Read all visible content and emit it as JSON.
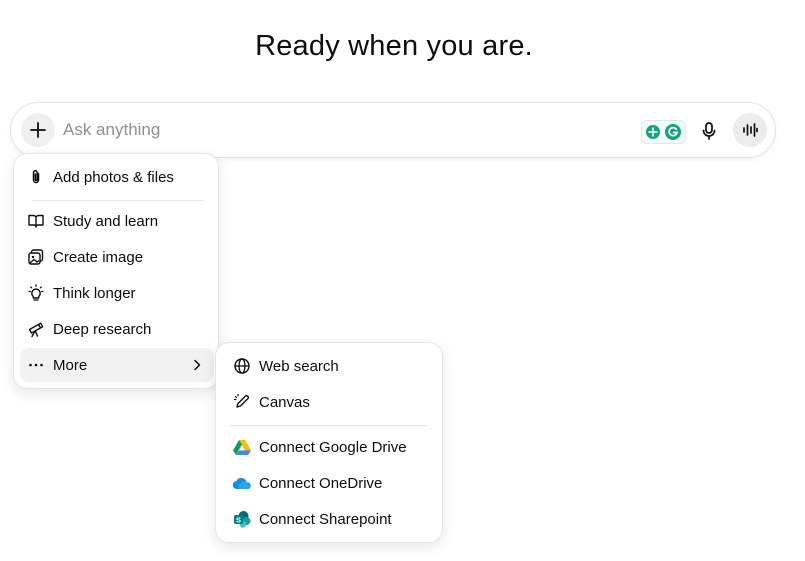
{
  "headline": "Ready when you are.",
  "composer": {
    "placeholder": "Ask anything",
    "value": ""
  },
  "attach_menu": {
    "items": [
      {
        "label": "Add photos & files",
        "icon": "paperclip-icon"
      },
      {
        "label": "Study and learn",
        "icon": "book-icon"
      },
      {
        "label": "Create image",
        "icon": "image-icon"
      },
      {
        "label": "Think longer",
        "icon": "lightbulb-icon"
      },
      {
        "label": "Deep research",
        "icon": "telescope-icon"
      },
      {
        "label": "More",
        "icon": "ellipsis-icon"
      }
    ]
  },
  "more_menu": {
    "items": [
      {
        "label": "Web search",
        "icon": "globe-icon"
      },
      {
        "label": "Canvas",
        "icon": "pen-icon"
      },
      {
        "label": "Connect Google Drive",
        "icon": "google-drive-icon"
      },
      {
        "label": "Connect OneDrive",
        "icon": "onedrive-icon"
      },
      {
        "label": "Connect Sharepoint",
        "icon": "sharepoint-icon"
      }
    ]
  },
  "colors": {
    "text": "#0d0d0d",
    "placeholder": "#8f8f8f",
    "hover": "#f1f1f1",
    "grammarly": "#15a37f"
  }
}
